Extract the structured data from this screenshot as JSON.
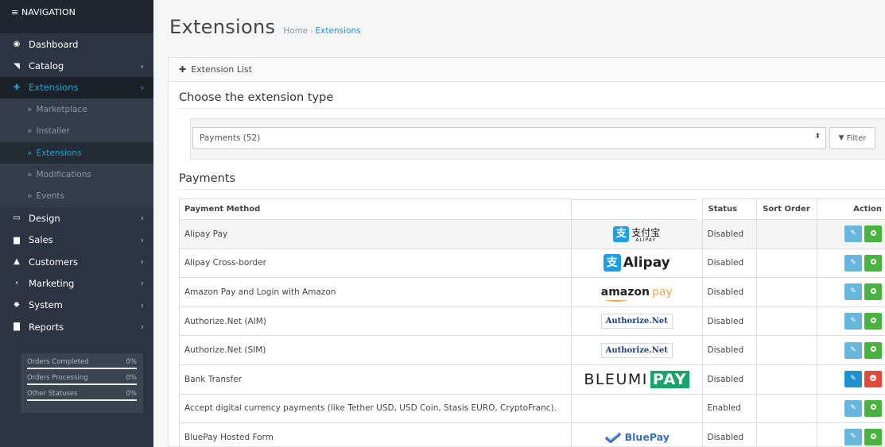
{
  "sidebar": {
    "header": "NAVIGATION",
    "items": [
      {
        "label": "Dashboard",
        "icon": "dashboard-icon",
        "glyph": "◉",
        "chevron": false
      },
      {
        "label": "Catalog",
        "icon": "tag-icon",
        "glyph": "◥",
        "chevron": true
      },
      {
        "label": "Extensions",
        "icon": "puzzle-icon",
        "glyph": "✚",
        "chevron": true,
        "active": true
      }
    ],
    "sub_items": [
      {
        "label": "Marketplace"
      },
      {
        "label": "Installer"
      },
      {
        "label": "Extensions",
        "active": true
      },
      {
        "label": "Modifications"
      },
      {
        "label": "Events"
      }
    ],
    "items_after": [
      {
        "label": "Design",
        "icon": "monitor-icon",
        "glyph": "▭"
      },
      {
        "label": "Sales",
        "icon": "cart-icon",
        "glyph": "▆"
      },
      {
        "label": "Customers",
        "icon": "user-icon",
        "glyph": "▲"
      },
      {
        "label": "Marketing",
        "icon": "share-icon",
        "glyph": "‹"
      },
      {
        "label": "System",
        "icon": "cog-icon",
        "glyph": "✸"
      },
      {
        "label": "Reports",
        "icon": "bar-chart-icon",
        "glyph": "▇"
      }
    ],
    "stats": [
      {
        "label": "Orders Completed",
        "value": "0%"
      },
      {
        "label": "Orders Processing",
        "value": "0%"
      },
      {
        "label": "Other Statuses",
        "value": "0%"
      }
    ]
  },
  "page": {
    "title": "Extensions",
    "breadcrumb": [
      "Home",
      "Extensions"
    ]
  },
  "panel": {
    "title": "Extension List",
    "choose_heading": "Choose the extension type",
    "select_value": "Payments (52)",
    "filter_label": "Filter",
    "section_heading": "Payments"
  },
  "table": {
    "columns": [
      "Payment Method",
      "",
      "Status",
      "Sort Order",
      "Action"
    ],
    "rows": [
      {
        "name": "Alipay Pay",
        "logo": "alipay-cn",
        "status": "Disabled",
        "sort": "",
        "installed": false,
        "highlight": true
      },
      {
        "name": "Alipay Cross-border",
        "logo": "alipay-en",
        "status": "Disabled",
        "sort": "",
        "installed": false
      },
      {
        "name": "Amazon Pay and Login with Amazon",
        "logo": "amazon",
        "status": "Disabled",
        "sort": "",
        "installed": false
      },
      {
        "name": "Authorize.Net (AIM)",
        "logo": "authnet",
        "status": "Disabled",
        "sort": "",
        "installed": false
      },
      {
        "name": "Authorize.Net (SIM)",
        "logo": "authnet",
        "status": "Disabled",
        "sort": "",
        "installed": false
      },
      {
        "name": "Bank Transfer",
        "logo": "bleumi",
        "status": "Disabled",
        "sort": "",
        "installed": true
      },
      {
        "name": "Accept digital currency payments (like Tether USD, USD Coin, Stasis EURO, CryptoFranc).",
        "logo": "",
        "status": "Enabled",
        "sort": "",
        "installed": false
      },
      {
        "name": "BluePay Hosted Form",
        "logo": "bluepay",
        "status": "Disabled",
        "sort": "",
        "installed": false
      }
    ]
  },
  "logos": {
    "alipay_cn_mark": "支",
    "alipay_cn_text": "支付宝",
    "alipay_cn_sub": "ALIPAY",
    "alipay_en_mark": "支",
    "alipay_en_text": "Alipay",
    "amazon_text": "amazon",
    "amazon_pay": "pay",
    "authnet_text": "Authorize.Net",
    "bleumi_text": "BLEUMI",
    "bleumi_pay": "PAY",
    "bluepay_text": "BluePay"
  },
  "colors": {
    "sidebar_bg": "#2b3440",
    "accent": "#1ea5d8",
    "edit_button": "#67b7dc",
    "install_button": "#49b340",
    "uninstall_button": "#e04a37"
  }
}
